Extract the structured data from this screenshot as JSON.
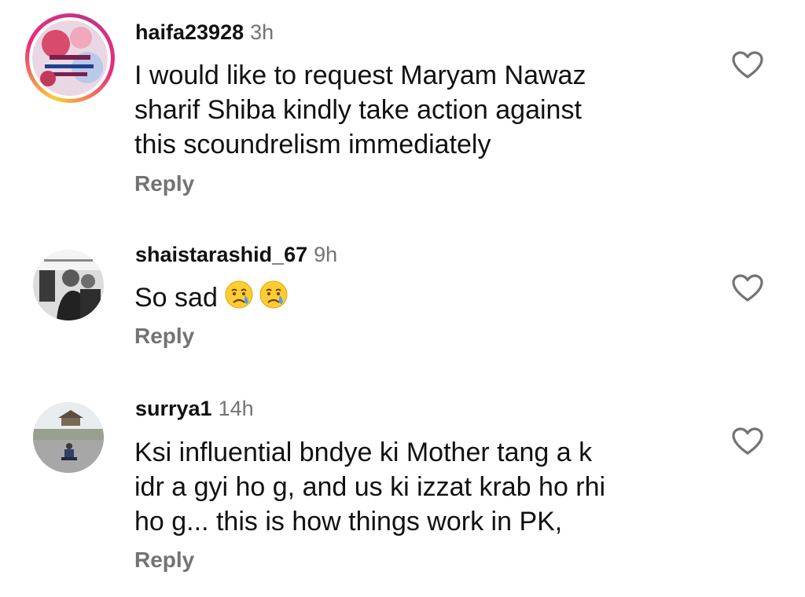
{
  "comments": [
    {
      "username": "haifa23928",
      "time": "3h",
      "lines": [
        "I would like to request Maryam Nawaz",
        "sharif Shiba kindly take action against",
        "this scoundrelism immediately"
      ],
      "reply_label": "Reply",
      "avatar": "stylized-image-avatar",
      "like_icon": "heart-outline-icon"
    },
    {
      "username": "shaistarashid_67",
      "time": "9h",
      "text": "So sad",
      "emojis": [
        "crying-face-emoji",
        "crying-face-emoji"
      ],
      "reply_label": "Reply",
      "avatar": "photo-avatar",
      "like_icon": "heart-outline-icon"
    },
    {
      "username": "surrya1",
      "time": "14h",
      "lines": [
        "Ksi influential bndye ki Mother tang a k",
        "idr a gyi ho g, and us ki izzat krab ho rhi",
        "ho g... this is how things work in PK,"
      ],
      "reply_label": "Reply",
      "avatar": "photo-avatar",
      "like_icon": "heart-outline-icon"
    }
  ],
  "colors": {
    "meta_gray": "#737373",
    "story_ring": [
      "#f9ce34",
      "#ee2a7b",
      "#c13584"
    ],
    "emoji_face": "#ffcc33",
    "emoji_tear": "#4aa3e8"
  }
}
